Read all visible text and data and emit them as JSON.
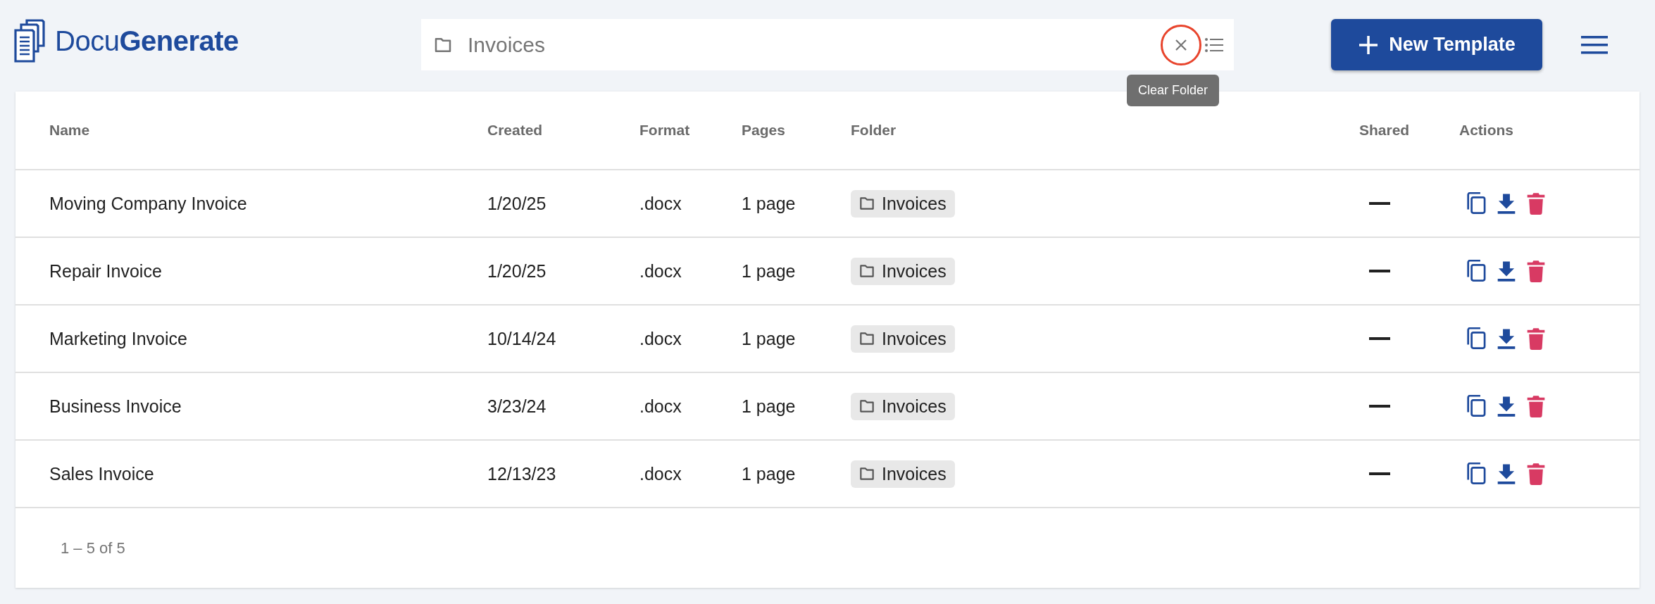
{
  "header": {
    "logo": "Docu**Generate**",
    "folder_field": {
      "value": "Invoices"
    },
    "tooltip": "Clear Folder",
    "new_button": "New Template"
  },
  "table": {
    "columns": [
      "Name",
      "Created",
      "Format",
      "Pages",
      "Folder",
      "Shared",
      "Actions"
    ],
    "rows": [
      {
        "name": "Moving Company Invoice",
        "created": "1/20/25",
        "format": ".docx",
        "pages": "1 page",
        "folder": "Invoices",
        "shared": false
      },
      {
        "name": "Repair Invoice",
        "created": "1/20/25",
        "format": ".docx",
        "pages": "1 page",
        "folder": "Invoices",
        "shared": false
      },
      {
        "name": "Marketing Invoice",
        "created": "10/14/24",
        "format": ".docx",
        "pages": "1 page",
        "folder": "Invoices",
        "shared": false
      },
      {
        "name": "Business Invoice",
        "created": "3/23/24",
        "format": ".docx",
        "pages": "1 page",
        "folder": "Invoices",
        "shared": false
      },
      {
        "name": "Sales Invoice",
        "created": "12/13/23",
        "format": ".docx",
        "pages": "1 page",
        "folder": "Invoices",
        "shared": false
      }
    ]
  },
  "pagination": "1 – 5 of 5"
}
